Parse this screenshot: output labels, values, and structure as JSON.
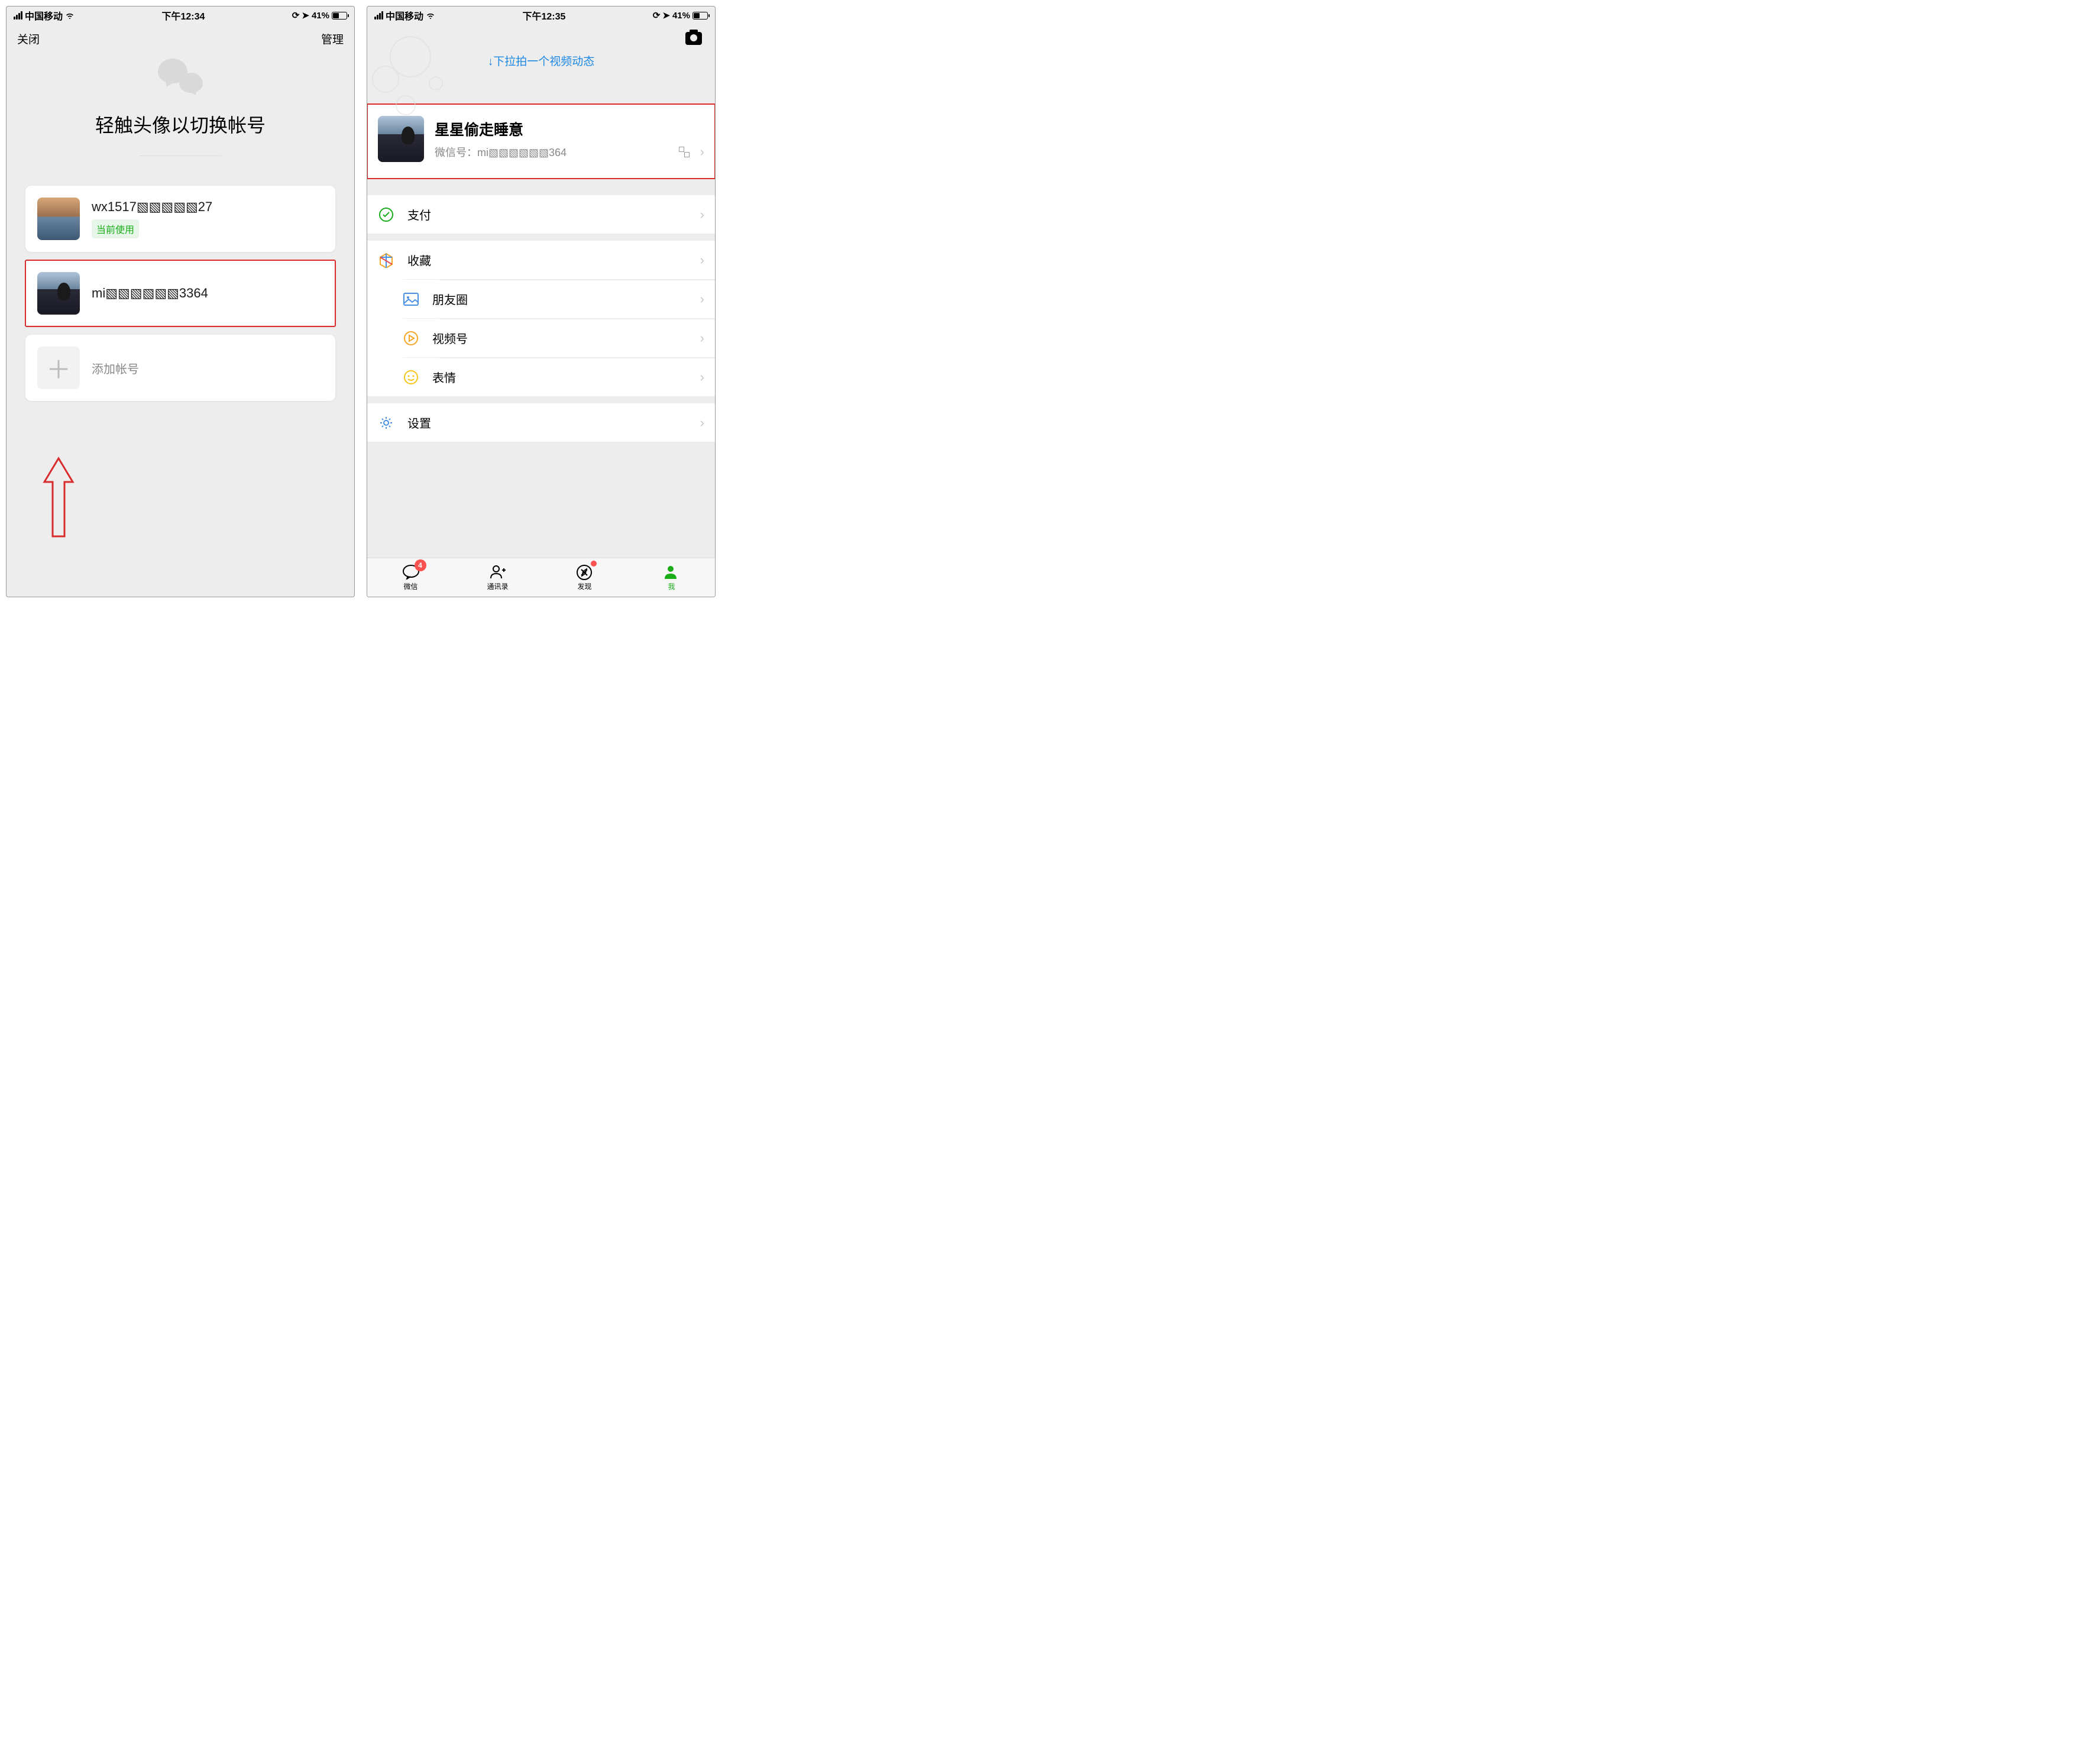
{
  "status": {
    "left_carrier": "中国移动",
    "right_battery": "41%",
    "nav_icon": "➤",
    "lock_icon": "⟳"
  },
  "left": {
    "time": "下午12:34",
    "nav_close": "关闭",
    "nav_manage": "管理",
    "title": "轻触头像以切换帐号",
    "accounts": [
      {
        "name": "wx1517▧▧▧▧▧27",
        "current_badge": "当前使用"
      },
      {
        "name": "mi▧▧▧▧▧▧3364"
      }
    ],
    "add_account": "添加帐号"
  },
  "right": {
    "time": "下午12:35",
    "pull_hint": "↓下拉拍一个视频动态",
    "profile": {
      "nickname": "星星偷走睡意",
      "wxid_label": "微信号：",
      "wxid_value": "mi▧▧▧▧▧▧364"
    },
    "menu": {
      "pay": "支付",
      "favorites": "收藏",
      "moments": "朋友圈",
      "channels": "视频号",
      "stickers": "表情",
      "settings": "设置"
    },
    "tabs": {
      "chat": "微信",
      "contacts": "通讯录",
      "discover": "发现",
      "me": "我",
      "chat_badge": "4"
    }
  }
}
